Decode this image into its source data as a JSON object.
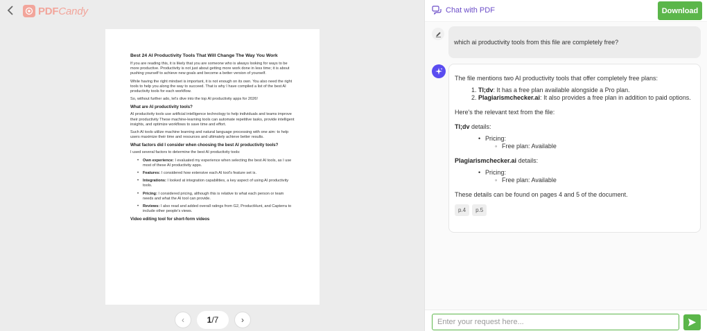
{
  "app": {
    "logo_bold": "PDF",
    "logo_italic": "Candy"
  },
  "document": {
    "title": "Best 24 AI Productivity Tools That Will Change The Way You Work",
    "intro_p1": "If you are reading this, it is likely that you are someone who is always looking for ways to be more productive. Productivity is not just about getting more work done in less time; it is about pushing yourself to achieve new goals and become a better version of yourself.",
    "intro_p2": "While having the right mindset is important, it is not enough on its own. You also need the right tools to help you along the way to succeed. That is why I have compiled a list of the best AI productivity tools for each workflow.",
    "intro_p3": "So, without further ado, let's dive into the top AI productivity apps for 2026!",
    "h_what": "What are AI productivity tools?",
    "what_p1": "AI productivity tools use artificial intelligence technology to help individuals and teams improve their productivity These machine-learning tools can automate repetitive tasks, provide intelligent insights, and optimize workflows to save time and effort.",
    "what_p2": "Such AI tools utilize machine learning and natural language processing with one aim: to help users maximize their time and resources and ultimately achieve better results.",
    "h_factors": "What factors did I consider when choosing the best AI productivity tools?",
    "factors_p": "I used several factors to determine the best AI productivity tools:",
    "factors": [
      {
        "term": "Own experience:",
        "text": " I evaluated my experience when selecting the best AI tools, as I use most of these AI productivity apps."
      },
      {
        "term": "Features:",
        "text": " I considered how extensive each AI tool's feature set is."
      },
      {
        "term": "Integrations:",
        "text": " I looked at integration capabilities, a key aspect of using AI productivity tools."
      },
      {
        "term": "Pricing:",
        "text": " I considered pricing, although this is relative to what each person or team needs and what the AI tool can provide."
      },
      {
        "term": "Reviews:",
        "text": " I also read and added overall ratings from G2, ProductHunt, and Capterra to include other people's views."
      }
    ],
    "h_video": "Video editing tool for short-form videos"
  },
  "pager": {
    "current": "1",
    "total": "/7",
    "prev_glyph": "‹",
    "next_glyph": "›"
  },
  "chat": {
    "title": "Chat with PDF",
    "download_label": "Download",
    "user_message": "which ai productivity tools from this file are completely free?",
    "ai": {
      "intro": "The file mentions two AI productivity tools that offer completely free plans:",
      "list": [
        {
          "name": "Tl;dv",
          "text": ": It has a free plan available alongside a Pro plan."
        },
        {
          "name": "Plagiarismchecker.ai",
          "text": ": It also provides a free plan in addition to paid options."
        }
      ],
      "relevant": "Here's the relevant text from the file:",
      "tool1_name": "Tl;dv",
      "tool2_name": "Plagiarismchecker.ai",
      "details_word": " details:",
      "pricing_label": "Pricing:",
      "free_plan": "Free plan: Available",
      "pages_note": "These details can be found on pages 4 and 5 of the document.",
      "chips": [
        "p.4",
        "p.5"
      ]
    },
    "input_placeholder": "Enter your request here...",
    "input_value": ""
  },
  "colors": {
    "accent_green": "#5bb64a",
    "brand_coral": "#f2a59b",
    "chat_purple": "#6b4cc8",
    "ai_avatar": "#5a4cf0"
  }
}
